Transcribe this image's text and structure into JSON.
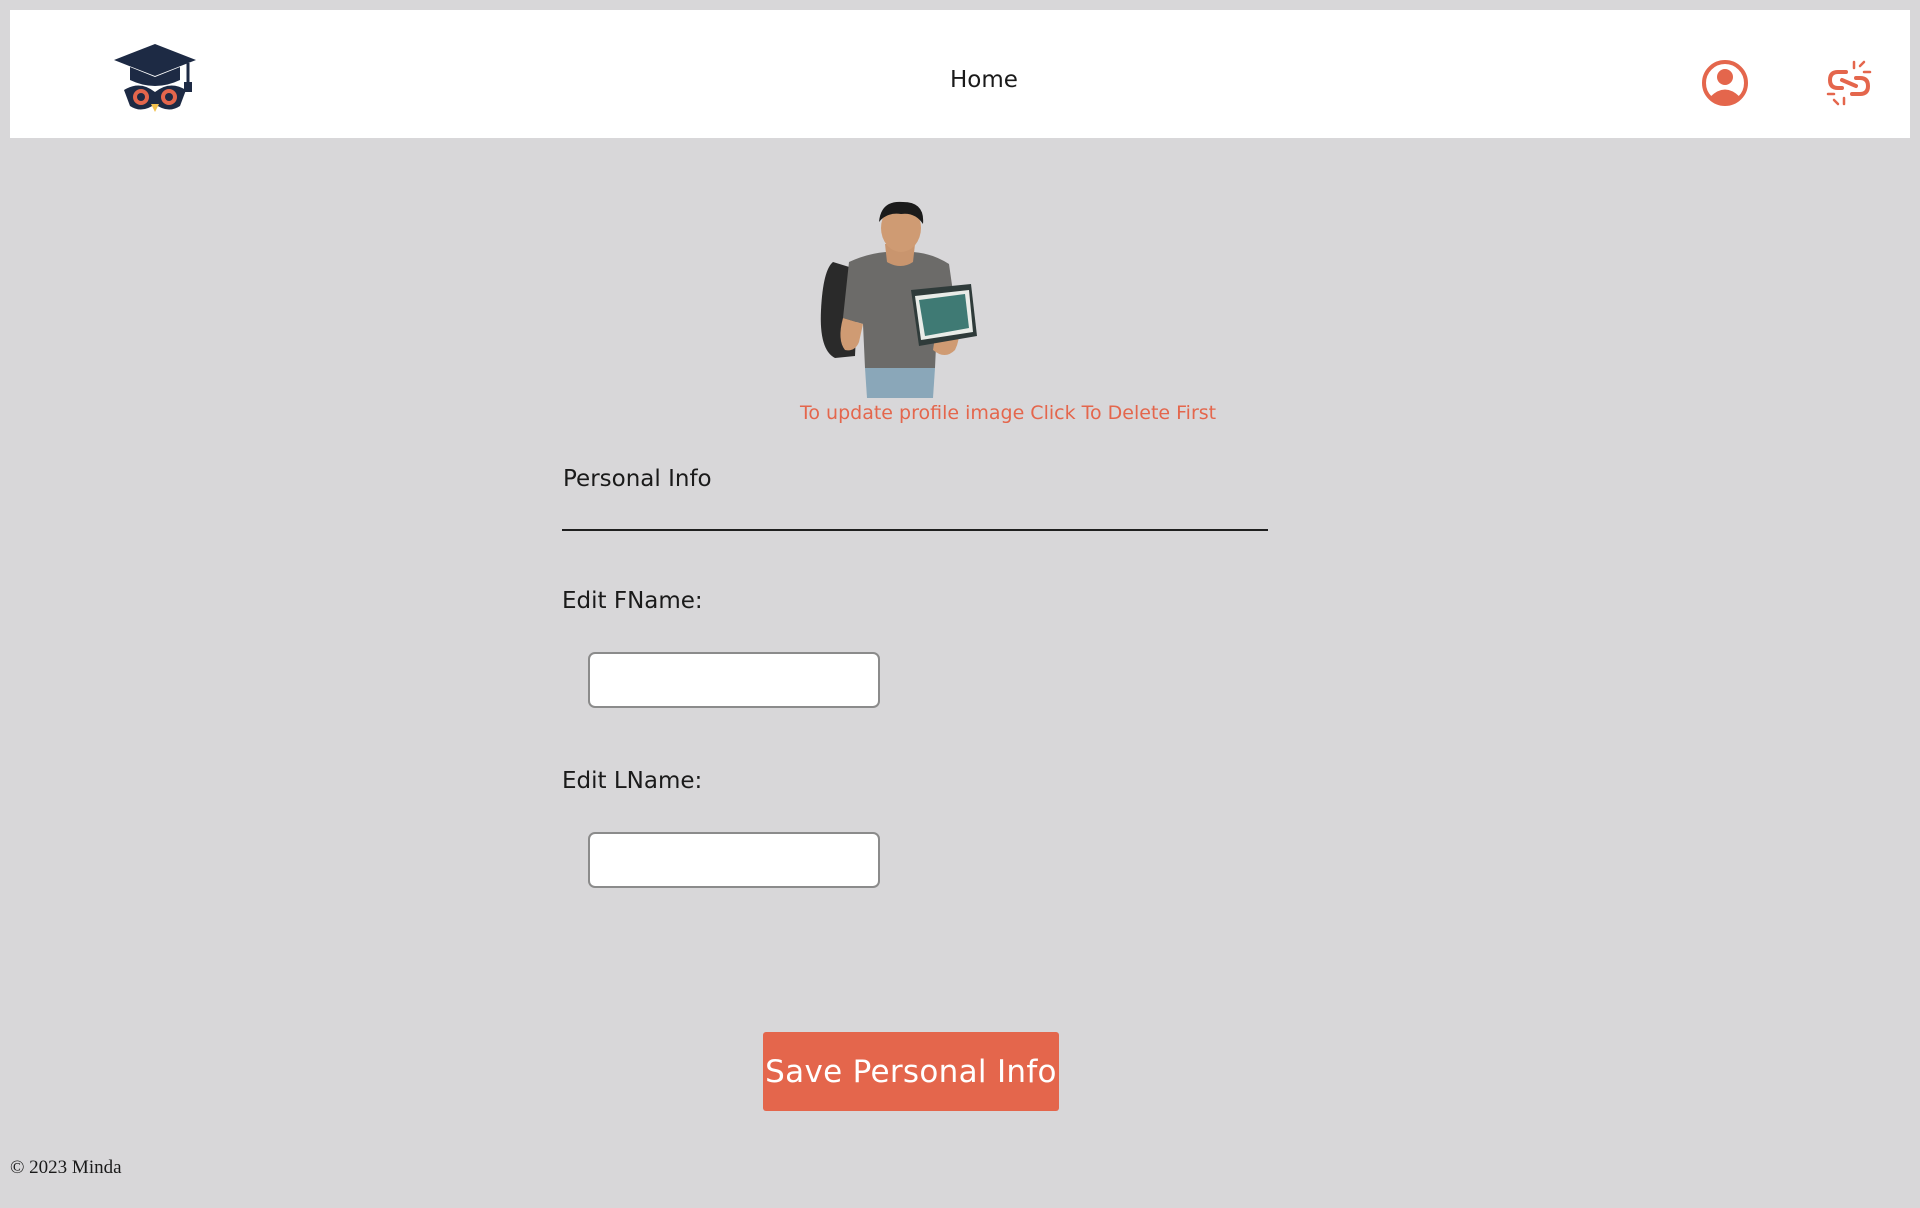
{
  "navbar": {
    "logo_icon": "graduation-cap-owl-icon",
    "home_label": "Home",
    "profile_icon": "user-circle-icon",
    "logout_icon": "broken-link-icon",
    "accent_color": "#e4664c"
  },
  "profile": {
    "avatar_icon": "student-photo",
    "delete_hint": "To update profile image Click To Delete First"
  },
  "personal_info": {
    "section_title": "Personal Info",
    "fname_label": "Edit FName:",
    "fname_value": "",
    "lname_label": "Edit LName:",
    "lname_value": "",
    "save_label": "Save Personal Info"
  },
  "footer": {
    "copyright": "© 2023 Minda"
  }
}
